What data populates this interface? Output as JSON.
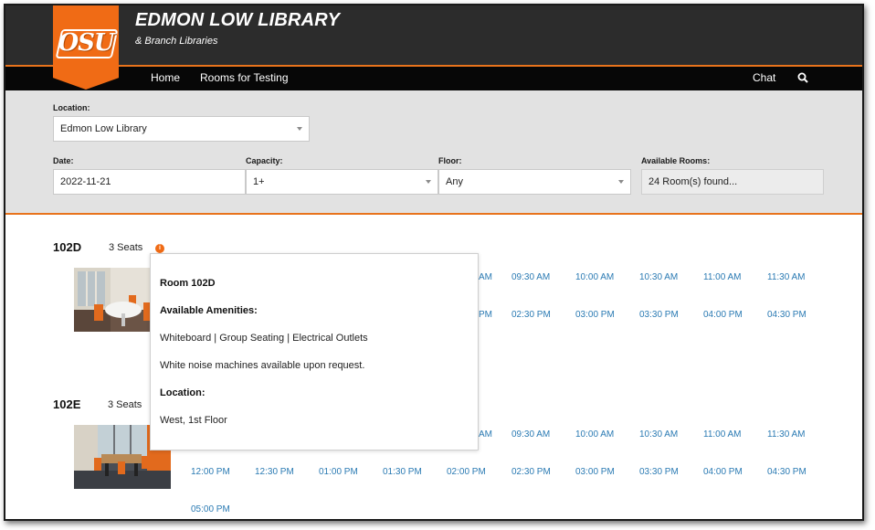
{
  "header": {
    "logo_text": "OSU",
    "title": "EDMON LOW LIBRARY",
    "subtitle": "& Branch Libraries",
    "accent_color": "#f06b15"
  },
  "nav": {
    "home": "Home",
    "rooms_for_testing": "Rooms for Testing",
    "chat": "Chat",
    "search_icon": "search-icon"
  },
  "filters": {
    "location_label": "Location:",
    "location_value": "Edmon Low Library",
    "date_label": "Date:",
    "date_value": "2022-11-21",
    "capacity_label": "Capacity:",
    "capacity_value": "1+",
    "floor_label": "Floor:",
    "floor_value": "Any",
    "available_label": "Available Rooms:",
    "available_value": "24 Room(s) found..."
  },
  "rooms": [
    {
      "name": "102D",
      "seats": "3 Seats",
      "row1": [
        "AM",
        "09:30 AM",
        "10:00 AM",
        "10:30 AM",
        "11:00 AM",
        "11:30 AM"
      ],
      "row2": [
        "PM",
        "02:30 PM",
        "03:00 PM",
        "03:30 PM",
        "04:00 PM",
        "04:30 PM"
      ]
    },
    {
      "name": "102E",
      "seats": "3 Seats",
      "row1": [
        "AM",
        "09:30 AM",
        "10:00 AM",
        "10:30 AM",
        "11:00 AM",
        "11:30 AM"
      ],
      "row2": [
        "12:00 PM",
        "12:30 PM",
        "01:00 PM",
        "01:30 PM",
        "02:00 PM",
        "02:30 PM",
        "03:00 PM",
        "03:30 PM",
        "04:00 PM",
        "04:30 PM"
      ],
      "row3": [
        "05:00 PM"
      ]
    }
  ],
  "popover": {
    "room_title": "Room 102D",
    "amenities_heading": "Available Amenities:",
    "amenities": "Whiteboard | Group Seating | Electrical Outlets",
    "note": "White noise machines available upon request.",
    "location_heading": "Location:",
    "location": "West, 1st Floor"
  }
}
